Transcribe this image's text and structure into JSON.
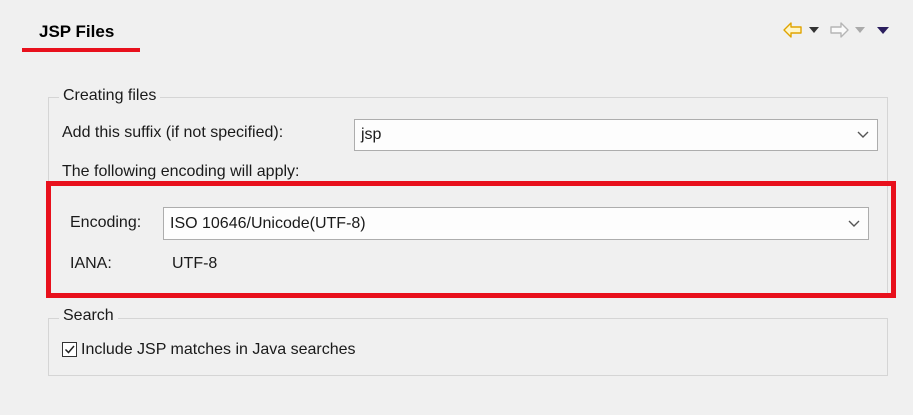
{
  "page": {
    "title": "JSP Files"
  },
  "creating_files": {
    "group_label": "Creating files",
    "suffix_label": "Add this suffix (if not specified):",
    "suffix_value": "jsp",
    "encoding_note": "The following encoding will apply:",
    "encoding_label": "Encoding:",
    "encoding_value": "ISO 10646/Unicode(UTF-8)",
    "iana_label": "IANA:",
    "iana_value": "UTF-8"
  },
  "search": {
    "group_label": "Search",
    "include_label": "Include JSP matches in Java searches",
    "include_checked": true
  },
  "colors": {
    "annotation_red": "#e8101c",
    "back_arrow": "#f0b800"
  }
}
